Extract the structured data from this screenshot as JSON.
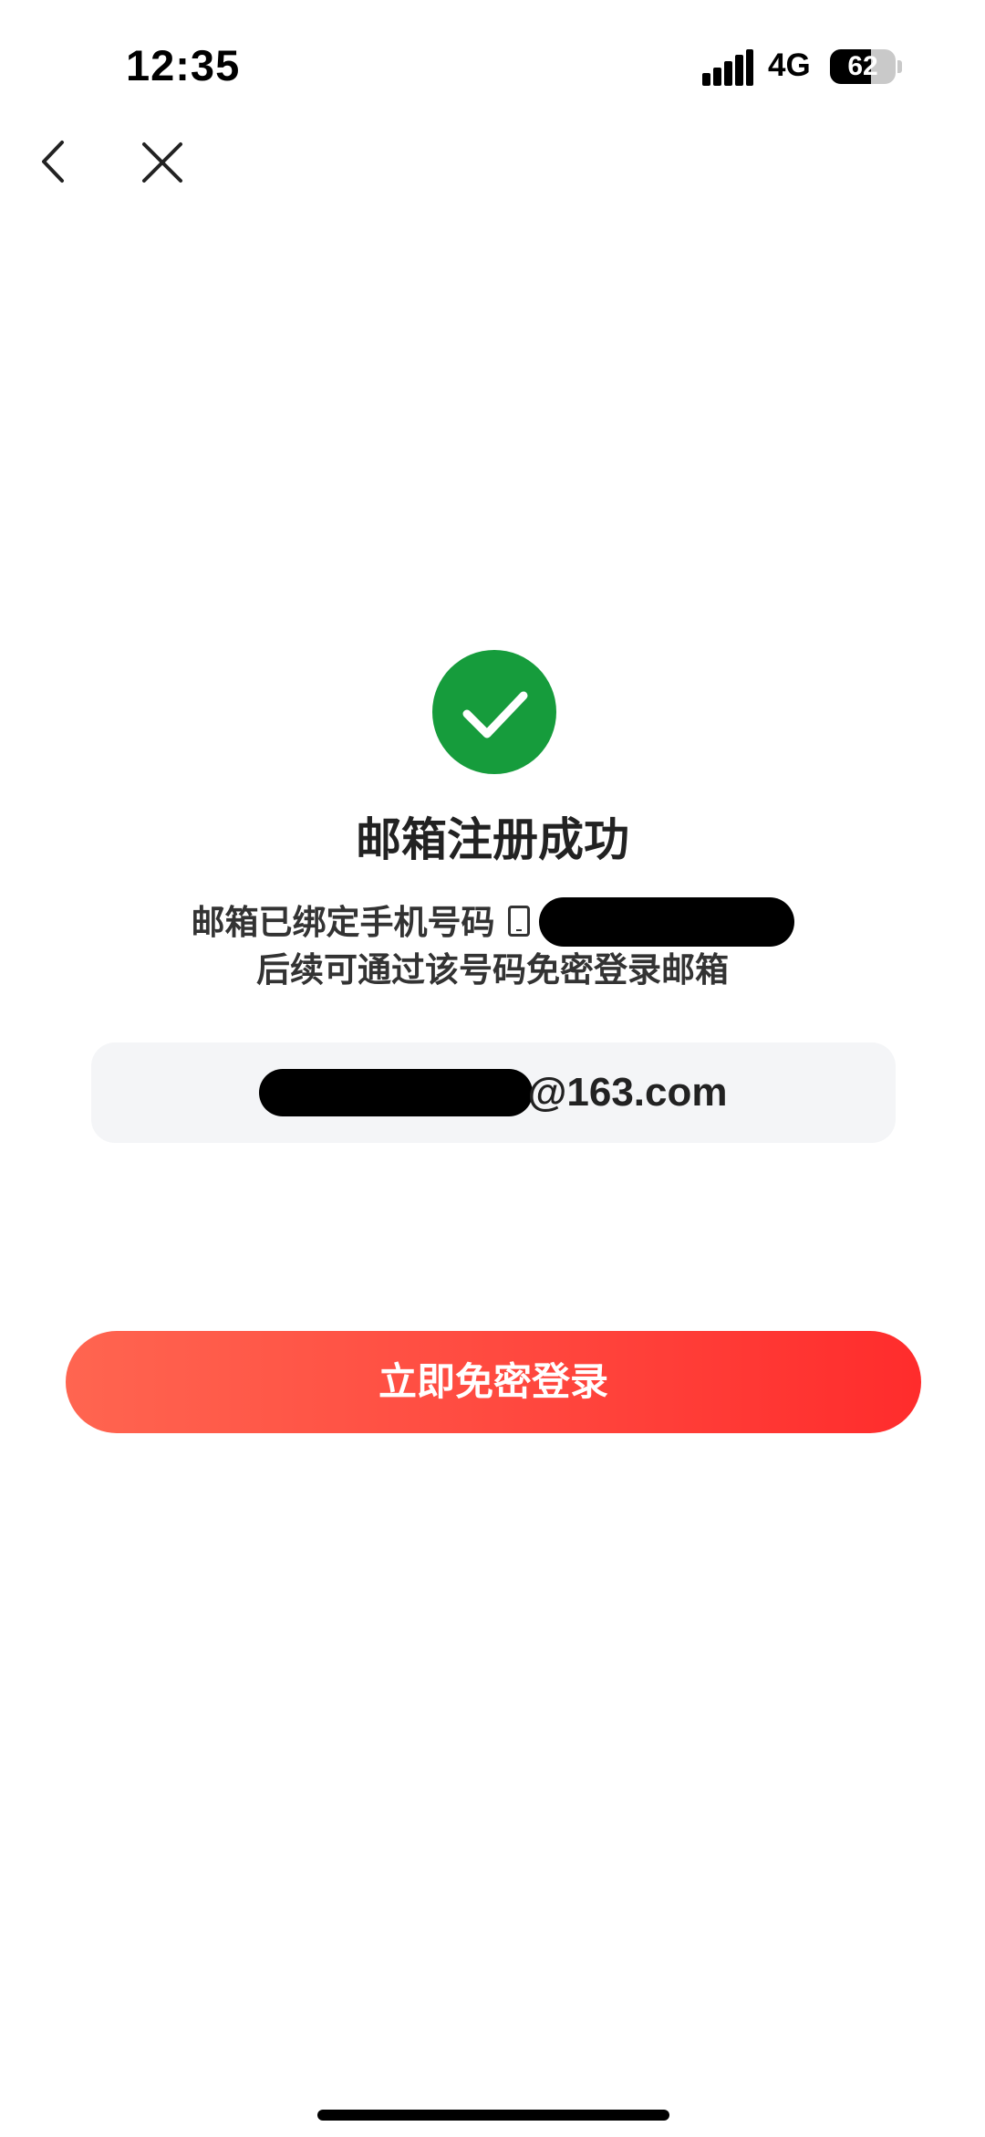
{
  "status_bar": {
    "time": "12:35",
    "network": "4G",
    "battery_level": "62"
  },
  "nav": {
    "back_icon": "chevron-left-icon",
    "close_icon": "close-icon"
  },
  "success": {
    "icon": "checkmark-icon",
    "icon_color": "#169c3c",
    "title": "邮箱注册成功",
    "line1_prefix": "邮箱已绑定手机号码",
    "line2": "后续可通过该号码免密登录邮箱"
  },
  "email": {
    "suffix": "@163.com"
  },
  "actions": {
    "login_label": "立即免密登录",
    "login_color_start": "#ff6550",
    "login_color_end": "#ff2c2c"
  }
}
